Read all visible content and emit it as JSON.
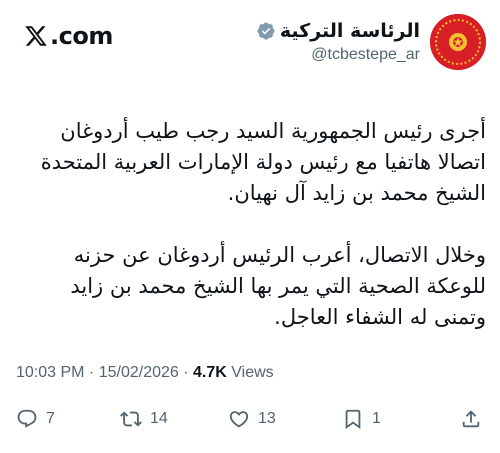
{
  "brand": {
    "wordmark": ".com"
  },
  "author": {
    "display_name": "الرئاسة التركية",
    "handle": "@tcbestepe_ar",
    "verified": true,
    "avatar_color": "#d91f26",
    "badge_color": "#829aab"
  },
  "tweet": {
    "paragraphs": [
      "أجرى رئيس الجمهورية السيد رجب طيب أردوغان اتصالا هاتفيا مع رئيس دولة الإمارات العربية المتحدة الشيخ محمد بن زايد آل نهيان.",
      "وخلال الاتصال، أعرب الرئيس أردوغان عن حزنه للوعكة الصحية التي يمر بها الشيخ محمد بن زايد وتمنى له الشفاء العاجل."
    ],
    "time": "10:03 PM",
    "sep": " · ",
    "date": "15/02/2026",
    "views_count": "4.7K",
    "views_label": "Views"
  },
  "actions": {
    "replies": "7",
    "reposts": "14",
    "likes": "13",
    "bookmarks": "1"
  },
  "icons": [
    "x-logo-icon",
    "verified-badge-icon",
    "crescent-star-emblem-icon",
    "reply-icon",
    "repost-icon",
    "like-icon",
    "bookmark-icon",
    "share-icon"
  ]
}
